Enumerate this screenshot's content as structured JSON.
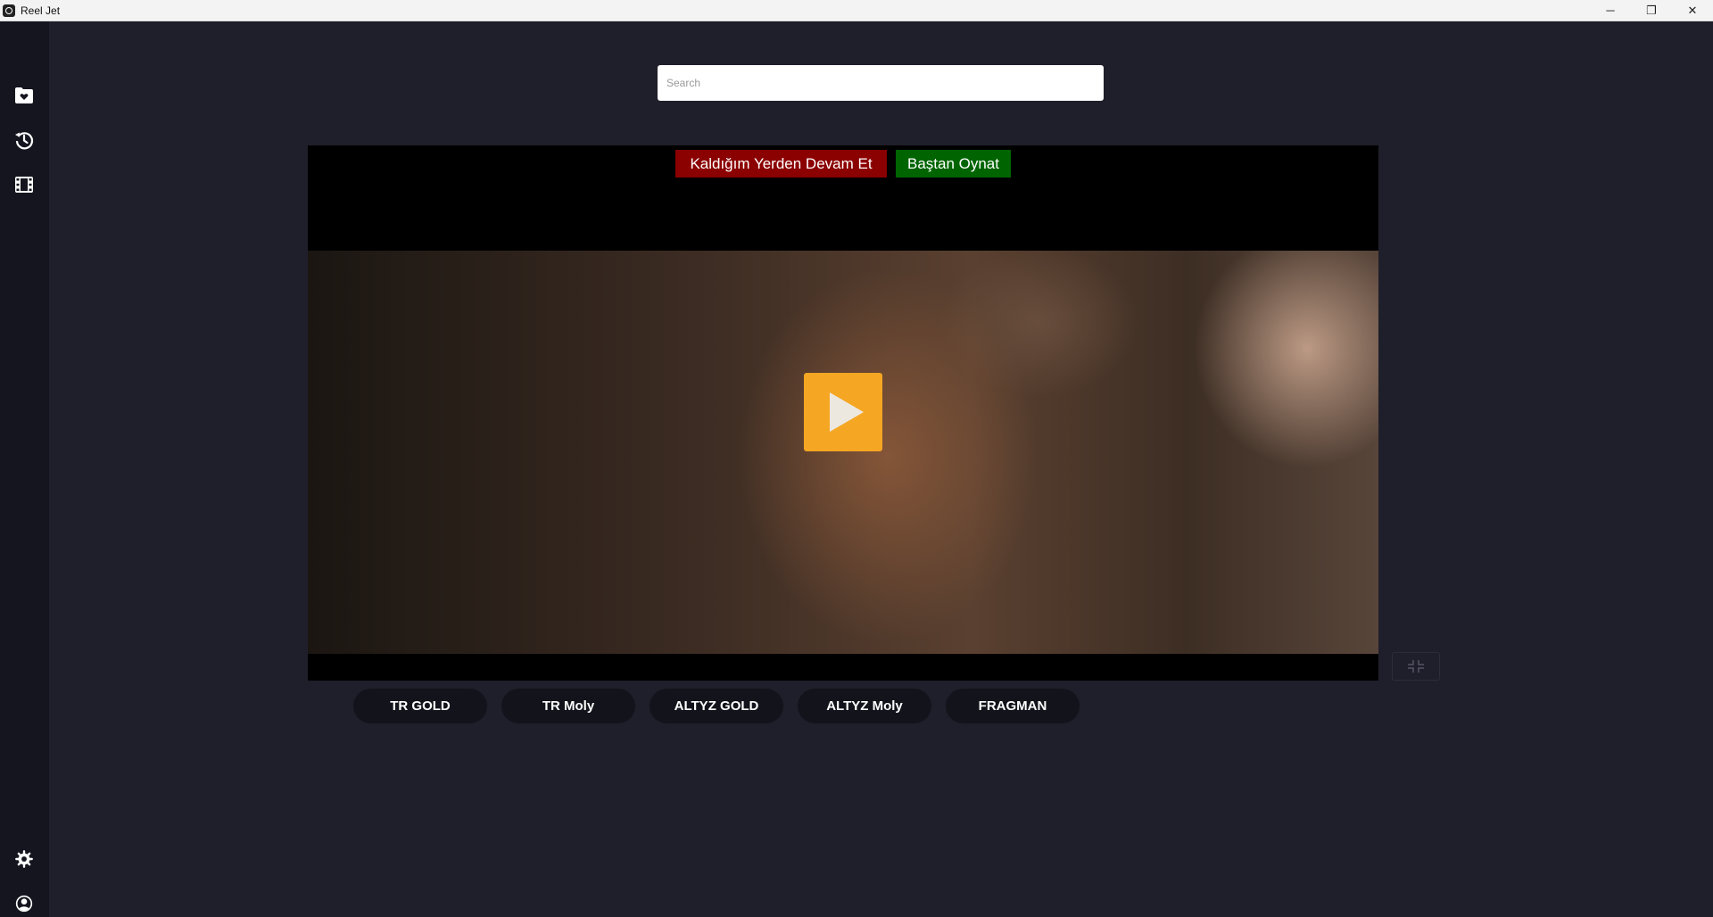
{
  "window": {
    "title": "Reel Jet",
    "minimize": "─",
    "maximize": "❐",
    "close": "✕"
  },
  "search": {
    "placeholder": "Search",
    "value": ""
  },
  "player": {
    "resume_label": "Kaldığım Yerden Devam Et",
    "restart_label": "Baştan Oynat",
    "resume_color": "#8b0000",
    "restart_color": "#006400",
    "play_color": "#f5a623"
  },
  "sources": [
    "TR GOLD",
    "TR Moly",
    "ALTYZ GOLD",
    "ALTYZ Moly",
    "FRAGMAN"
  ],
  "sidebar": {
    "icons": [
      "favorites-folder-icon",
      "history-icon",
      "movies-icon",
      "settings-icon",
      "account-icon"
    ]
  }
}
